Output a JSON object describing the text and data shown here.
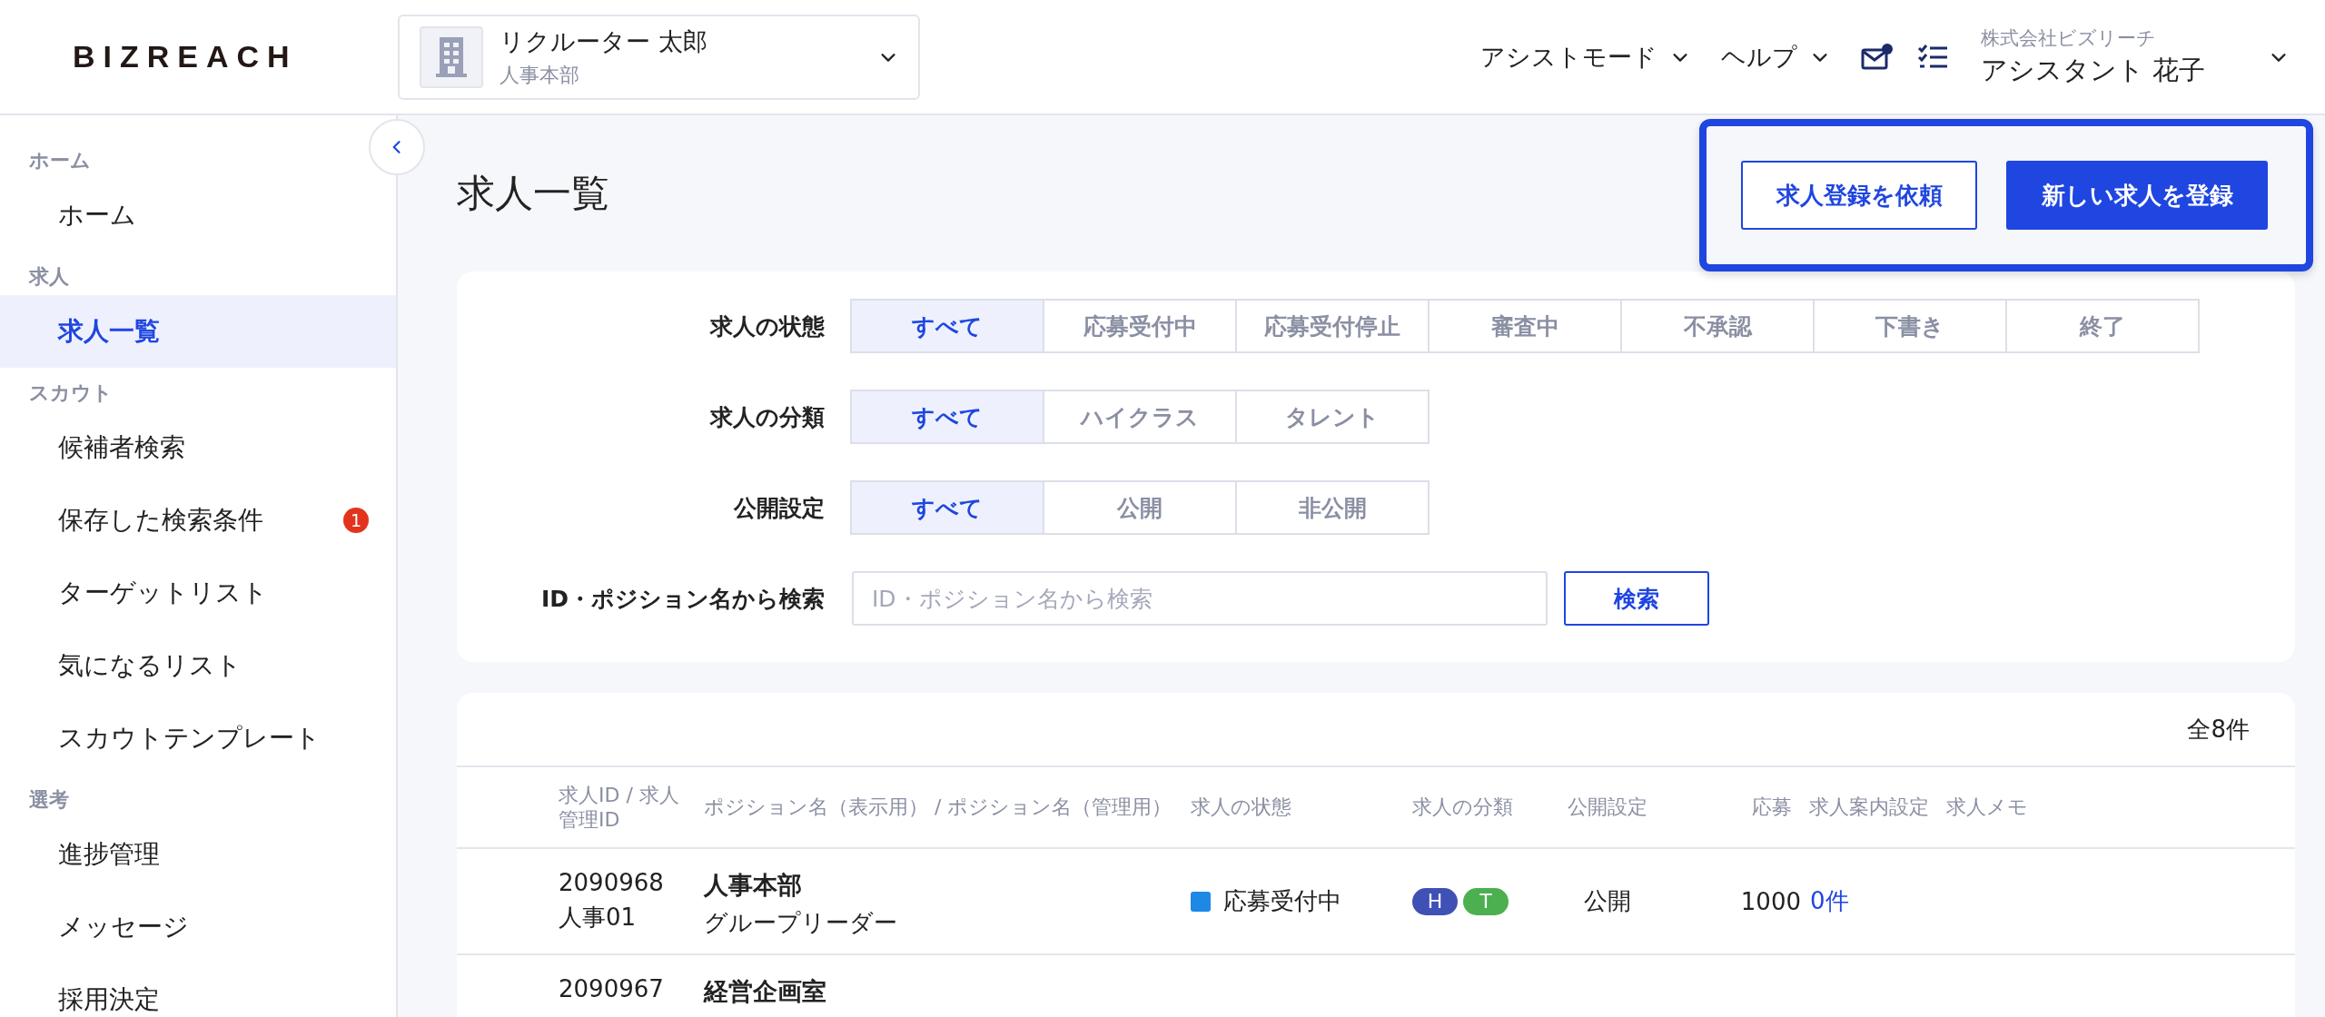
{
  "header": {
    "logo": "BIZREACH",
    "account": {
      "name": "リクルーター 太郎",
      "department": "人事本部"
    },
    "menus": [
      {
        "label": "アシストモード"
      },
      {
        "label": "ヘルプ"
      }
    ],
    "user": {
      "company": "株式会社ビズリーチ",
      "name": "アシスタント 花子"
    }
  },
  "sidebar": {
    "sections": [
      {
        "title": "ホーム",
        "items": [
          {
            "label": "ホーム",
            "selected": false
          }
        ]
      },
      {
        "title": "求人",
        "items": [
          {
            "label": "求人一覧",
            "selected": true
          }
        ]
      },
      {
        "title": "スカウト",
        "items": [
          {
            "label": "候補者検索",
            "selected": false
          },
          {
            "label": "保存した検索条件",
            "selected": false,
            "badge": "1"
          },
          {
            "label": "ターゲットリスト",
            "selected": false
          },
          {
            "label": "気になるリスト",
            "selected": false
          },
          {
            "label": "スカウトテンプレート",
            "selected": false
          }
        ]
      },
      {
        "title": "選考",
        "items": [
          {
            "label": "進捗管理",
            "selected": false
          },
          {
            "label": "メッセージ",
            "selected": false
          },
          {
            "label": "採用決定",
            "selected": false
          }
        ]
      }
    ]
  },
  "page": {
    "title": "求人一覧",
    "actions_highlighted": true,
    "actions": [
      {
        "label": "求人登録を依頼",
        "kind": "secondary"
      },
      {
        "label": "新しい求人を登録",
        "kind": "primary"
      }
    ]
  },
  "filters": [
    {
      "label": "求人の状態",
      "options": [
        {
          "label": "すべて",
          "selected": true
        },
        {
          "label": "応募受付中",
          "selected": false
        },
        {
          "label": "応募受付停止",
          "selected": false
        },
        {
          "label": "審査中",
          "selected": false
        },
        {
          "label": "不承認",
          "selected": false
        },
        {
          "label": "下書き",
          "selected": false
        },
        {
          "label": "終了",
          "selected": false
        }
      ]
    },
    {
      "label": "求人の分類",
      "options": [
        {
          "label": "すべて",
          "selected": true
        },
        {
          "label": "ハイクラス",
          "selected": false
        },
        {
          "label": "タレント",
          "selected": false
        }
      ]
    },
    {
      "label": "公開設定",
      "options": [
        {
          "label": "すべて",
          "selected": true
        },
        {
          "label": "公開",
          "selected": false
        },
        {
          "label": "非公開",
          "selected": false
        }
      ]
    }
  ],
  "search": {
    "label": "ID・ポジション名から検索",
    "placeholder": "ID・ポジション名から検索",
    "button": "検索"
  },
  "table": {
    "total": "全8件",
    "columns": [
      "求人ID / 求人管理ID",
      "ポジション名（表示用） / ポジション名（管理用）",
      "求人の状態",
      "求人の分類",
      "公開設定",
      "応募",
      "求人案内設定",
      "求人メモ"
    ],
    "rows": [
      {
        "id": "2090968",
        "manage_id": "人事01",
        "department": "人事本部",
        "position": "グループリーダー",
        "status": "応募受付中",
        "color": "#1e88e5",
        "tags": [
          {
            "label": "H",
            "color": "#3f51b5"
          },
          {
            "label": "T",
            "color": "#4caf50"
          }
        ],
        "visibility": "公開",
        "applications": "1000",
        "guide": "0件"
      },
      {
        "id": "2090967",
        "department": "経営企画室"
      }
    ]
  }
}
